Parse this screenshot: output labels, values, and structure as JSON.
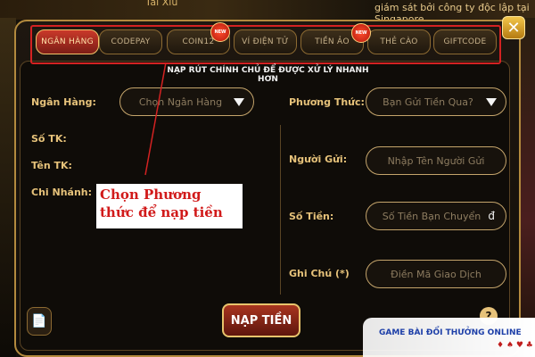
{
  "background": {
    "top_left_text": "Tài Xỉu",
    "top_right_text": "giám sát bởi công ty độc lập tại Singapore"
  },
  "tabs": [
    {
      "label": "NGÂN HÀNG",
      "active": true,
      "new": false
    },
    {
      "label": "CODEPAY",
      "active": false,
      "new": false
    },
    {
      "label": "COIN12",
      "active": false,
      "new": true
    },
    {
      "label": "VÍ ĐIỆN TỬ",
      "active": false,
      "new": false
    },
    {
      "label": "TIỀN ẢO",
      "active": false,
      "new": true
    },
    {
      "label": "THẺ CÀO",
      "active": false,
      "new": false
    },
    {
      "label": "GIFTCODE",
      "active": false,
      "new": false
    }
  ],
  "new_badge_text": "NEW",
  "close_label": "✕",
  "subtitle": "NẠP RÚT CHÍNH CHỦ ĐỂ ĐƯỢC XỬ LÝ NHANH HƠN",
  "left": {
    "bank_label": "Ngân Hàng:",
    "bank_select": "Chọn Ngân Hàng",
    "account_no_label": "Số TK:",
    "account_name_label": "Tên TK:",
    "branch_label": "Chi Nhánh:"
  },
  "right": {
    "method_label": "Phương Thức:",
    "method_select": "Bạn Gửi Tiền Qua?",
    "sender_label": "Người Gửi:",
    "sender_placeholder": "Nhập Tên Người Gửi",
    "amount_label": "Số Tiền:",
    "amount_placeholder": "Số Tiền Bạn Chuyển",
    "currency_symbol": "đ",
    "note_label": "Ghi Chú (*)",
    "note_placeholder": "Điền Mã Giao Dịch"
  },
  "submit_label": "NẠP TIỀN",
  "history_icon": "📄",
  "help_icon": "?",
  "annotation": "Chọn Phương thức để nạp tiền",
  "watermark": {
    "text": "GAME BÀI ĐỔI THƯỞNG ONLINE",
    "suits": "♦ ♠ ♥ ♣"
  },
  "colors": {
    "accent_gold": "#e6c27a",
    "active_tab": "#c9392a",
    "annotation_red": "#d11a1a"
  }
}
